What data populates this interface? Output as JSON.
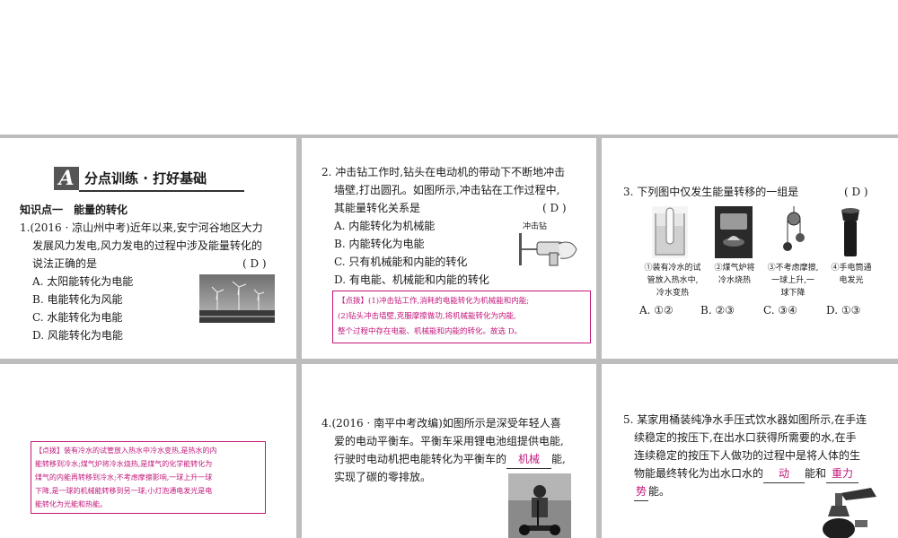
{
  "section_title": "分点训练 · 打好基础",
  "section_badge": "A",
  "knowledge_point": "知识点一　能量的转化",
  "q1": {
    "lines": [
      "1.(2016 · 凉山州中考)近年以来,安宁河谷地区大力",
      "发展风力发电,风力发电的过程中涉及能量转化的",
      "说法正确的是"
    ],
    "answer": "( D )",
    "options": [
      "A. 太阳能转化为电能",
      "B. 电能转化为风能",
      "C. 水能转化为电能",
      "D. 风能转化为电能"
    ]
  },
  "q2": {
    "lines": [
      "2. 冲击钻工作时,钻头在电动机的带动下不断地冲击",
      "墙壁,打出圆孔。如图所示,冲击钻在工作过程中,",
      "其能量转化关系是"
    ],
    "answer": "( D )",
    "options": [
      "A. 内能转化为机械能",
      "B. 内能转化为电能",
      "C. 只有机械能和内能的转化",
      "D. 有电能、机械能和内能的转化"
    ],
    "image_label": "冲击钻",
    "tip": [
      "【点拨】(1)冲击钻工作,消耗的电能转化为机械能和内能;",
      "(2)钻头冲击墙壁,克服摩擦做功,将机械能转化为内能,",
      "整个过程中存在电能、机械能和内能的转化。故选 D。"
    ]
  },
  "q3": {
    "stem": "3. 下列图中仅发生能量转移的一组是",
    "answer": "( D )",
    "captions": [
      [
        "①装有冷水的试",
        "管放入热水中,",
        "冷水变热"
      ],
      [
        "②煤气炉将",
        "冷水烧热"
      ],
      [
        "③不考虑摩擦,",
        "一球上升,一",
        "球下降"
      ],
      [
        "④手电筒通",
        "电发光"
      ]
    ],
    "options": [
      "A. ①②",
      "B. ②③",
      "C. ③④",
      "D. ①③"
    ]
  },
  "q3_tip": [
    "【点拨】装有冷水的试管放入热水中冷水变热,是热水的内",
    "能转移到冷水;煤气炉将冷水烧热,是煤气的化学能转化为",
    "煤气的内能再转移到冷水;不考虑摩擦影响,一球上升一球",
    "下降,是一球的机械能转移到另一球;小灯泡通电发光是电",
    "能转化为光能和热能。"
  ],
  "q4": {
    "line1": "4.(2016 · 南平中考改编)如图所示是深受年轻人喜",
    "line2": "爱的电动平衡车。平衡车采用锂电池组提供电能,",
    "line3_pre": "行驶时电动机把电能转化为平衡车的",
    "blank": "机械",
    "line3_post": "能,",
    "line4": "实现了碳的零排放。"
  },
  "q5": {
    "line1": "5. 某家用桶装纯净水手压式饮水器如图所示,在手连",
    "line2": "续稳定的按压下,在出水口获得所需要的水,在手",
    "line3": "连续稳定的按压下人做功的过程中是将人体的生",
    "line4_pre": "物能最终转化为出水口水的",
    "blank1": "动",
    "line4_mid": "能和",
    "blank2a": "重力",
    "blank2b": "势",
    "line5_post": "能。"
  },
  "colors": {
    "accent": "#c2187a",
    "gutter": "#bdbdbd"
  }
}
